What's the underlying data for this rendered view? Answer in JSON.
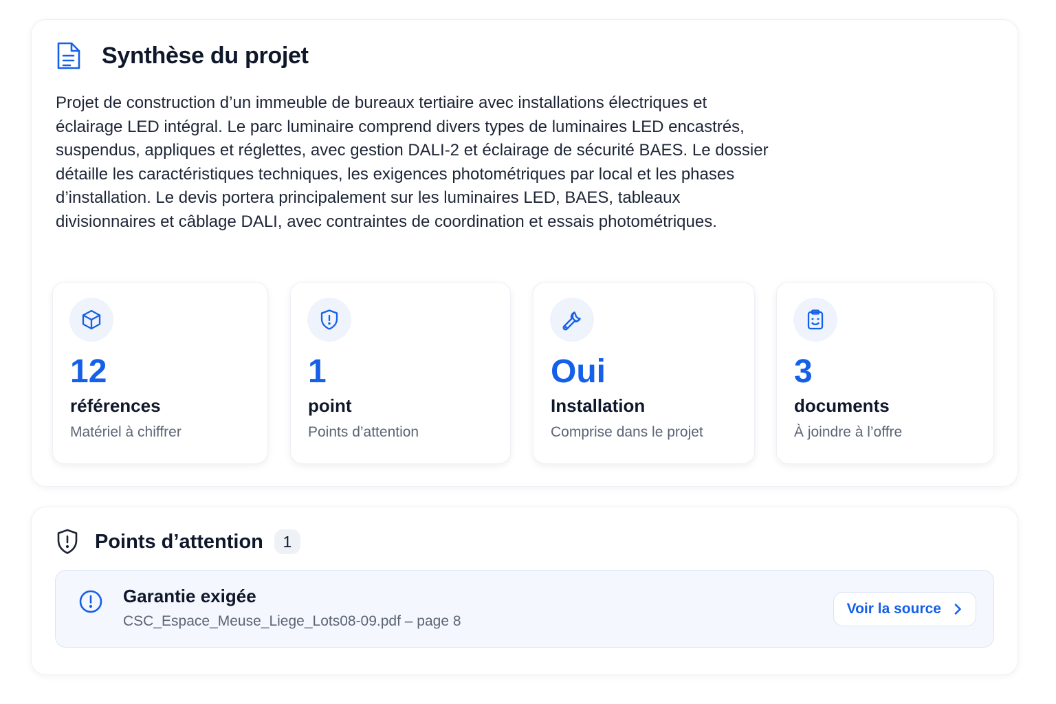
{
  "summary": {
    "title": "Synthèse du projet",
    "icon": "document-icon",
    "description": "Projet de construction d’un immeuble de bureaux tertiaire avec installations électriques et éclairage LED intégral. Le parc luminaire comprend divers types de luminaires LED encastrés, suspendus, appliques et réglettes, avec gestion DALI-2 et éclairage de sécurité BAES. Le dossier détaille les caractéristiques techniques, les exigences photométriques par local et les phases d’installation. Le devis portera principalement sur les luminaires LED, BAES, tableaux divisionnaires et câblage DALI, avec contraintes de coordination et essais photométriques."
  },
  "stats": [
    {
      "icon": "cube-icon",
      "value": "12",
      "label": "références",
      "sublabel": "Matériel à chiffrer"
    },
    {
      "icon": "shield-alert-icon",
      "value": "1",
      "label": "point",
      "sublabel": "Points d’attention"
    },
    {
      "icon": "wrench-icon",
      "value": "Oui",
      "label": "Installation",
      "sublabel": "Comprise dans le projet"
    },
    {
      "icon": "clipboard-icon",
      "value": "3",
      "label": "documents",
      "sublabel": "À joindre à l’offre"
    }
  ],
  "attention": {
    "title": "Points d’attention",
    "icon": "shield-alert-icon",
    "count": "1",
    "items": [
      {
        "icon": "info-circle-icon",
        "title": "Garantie exigée",
        "source": "CSC_Espace_Meuse_Liege_Lots08-09.pdf – page 8",
        "button_label": "Voir la source",
        "button_icon": "chevron-right-icon"
      }
    ]
  },
  "colors": {
    "accent": "#1560e8",
    "text": "#0f172a",
    "muted": "#5b6474",
    "icon_bg": "#eef3fc",
    "alert_bg": "#f4f7fd"
  }
}
